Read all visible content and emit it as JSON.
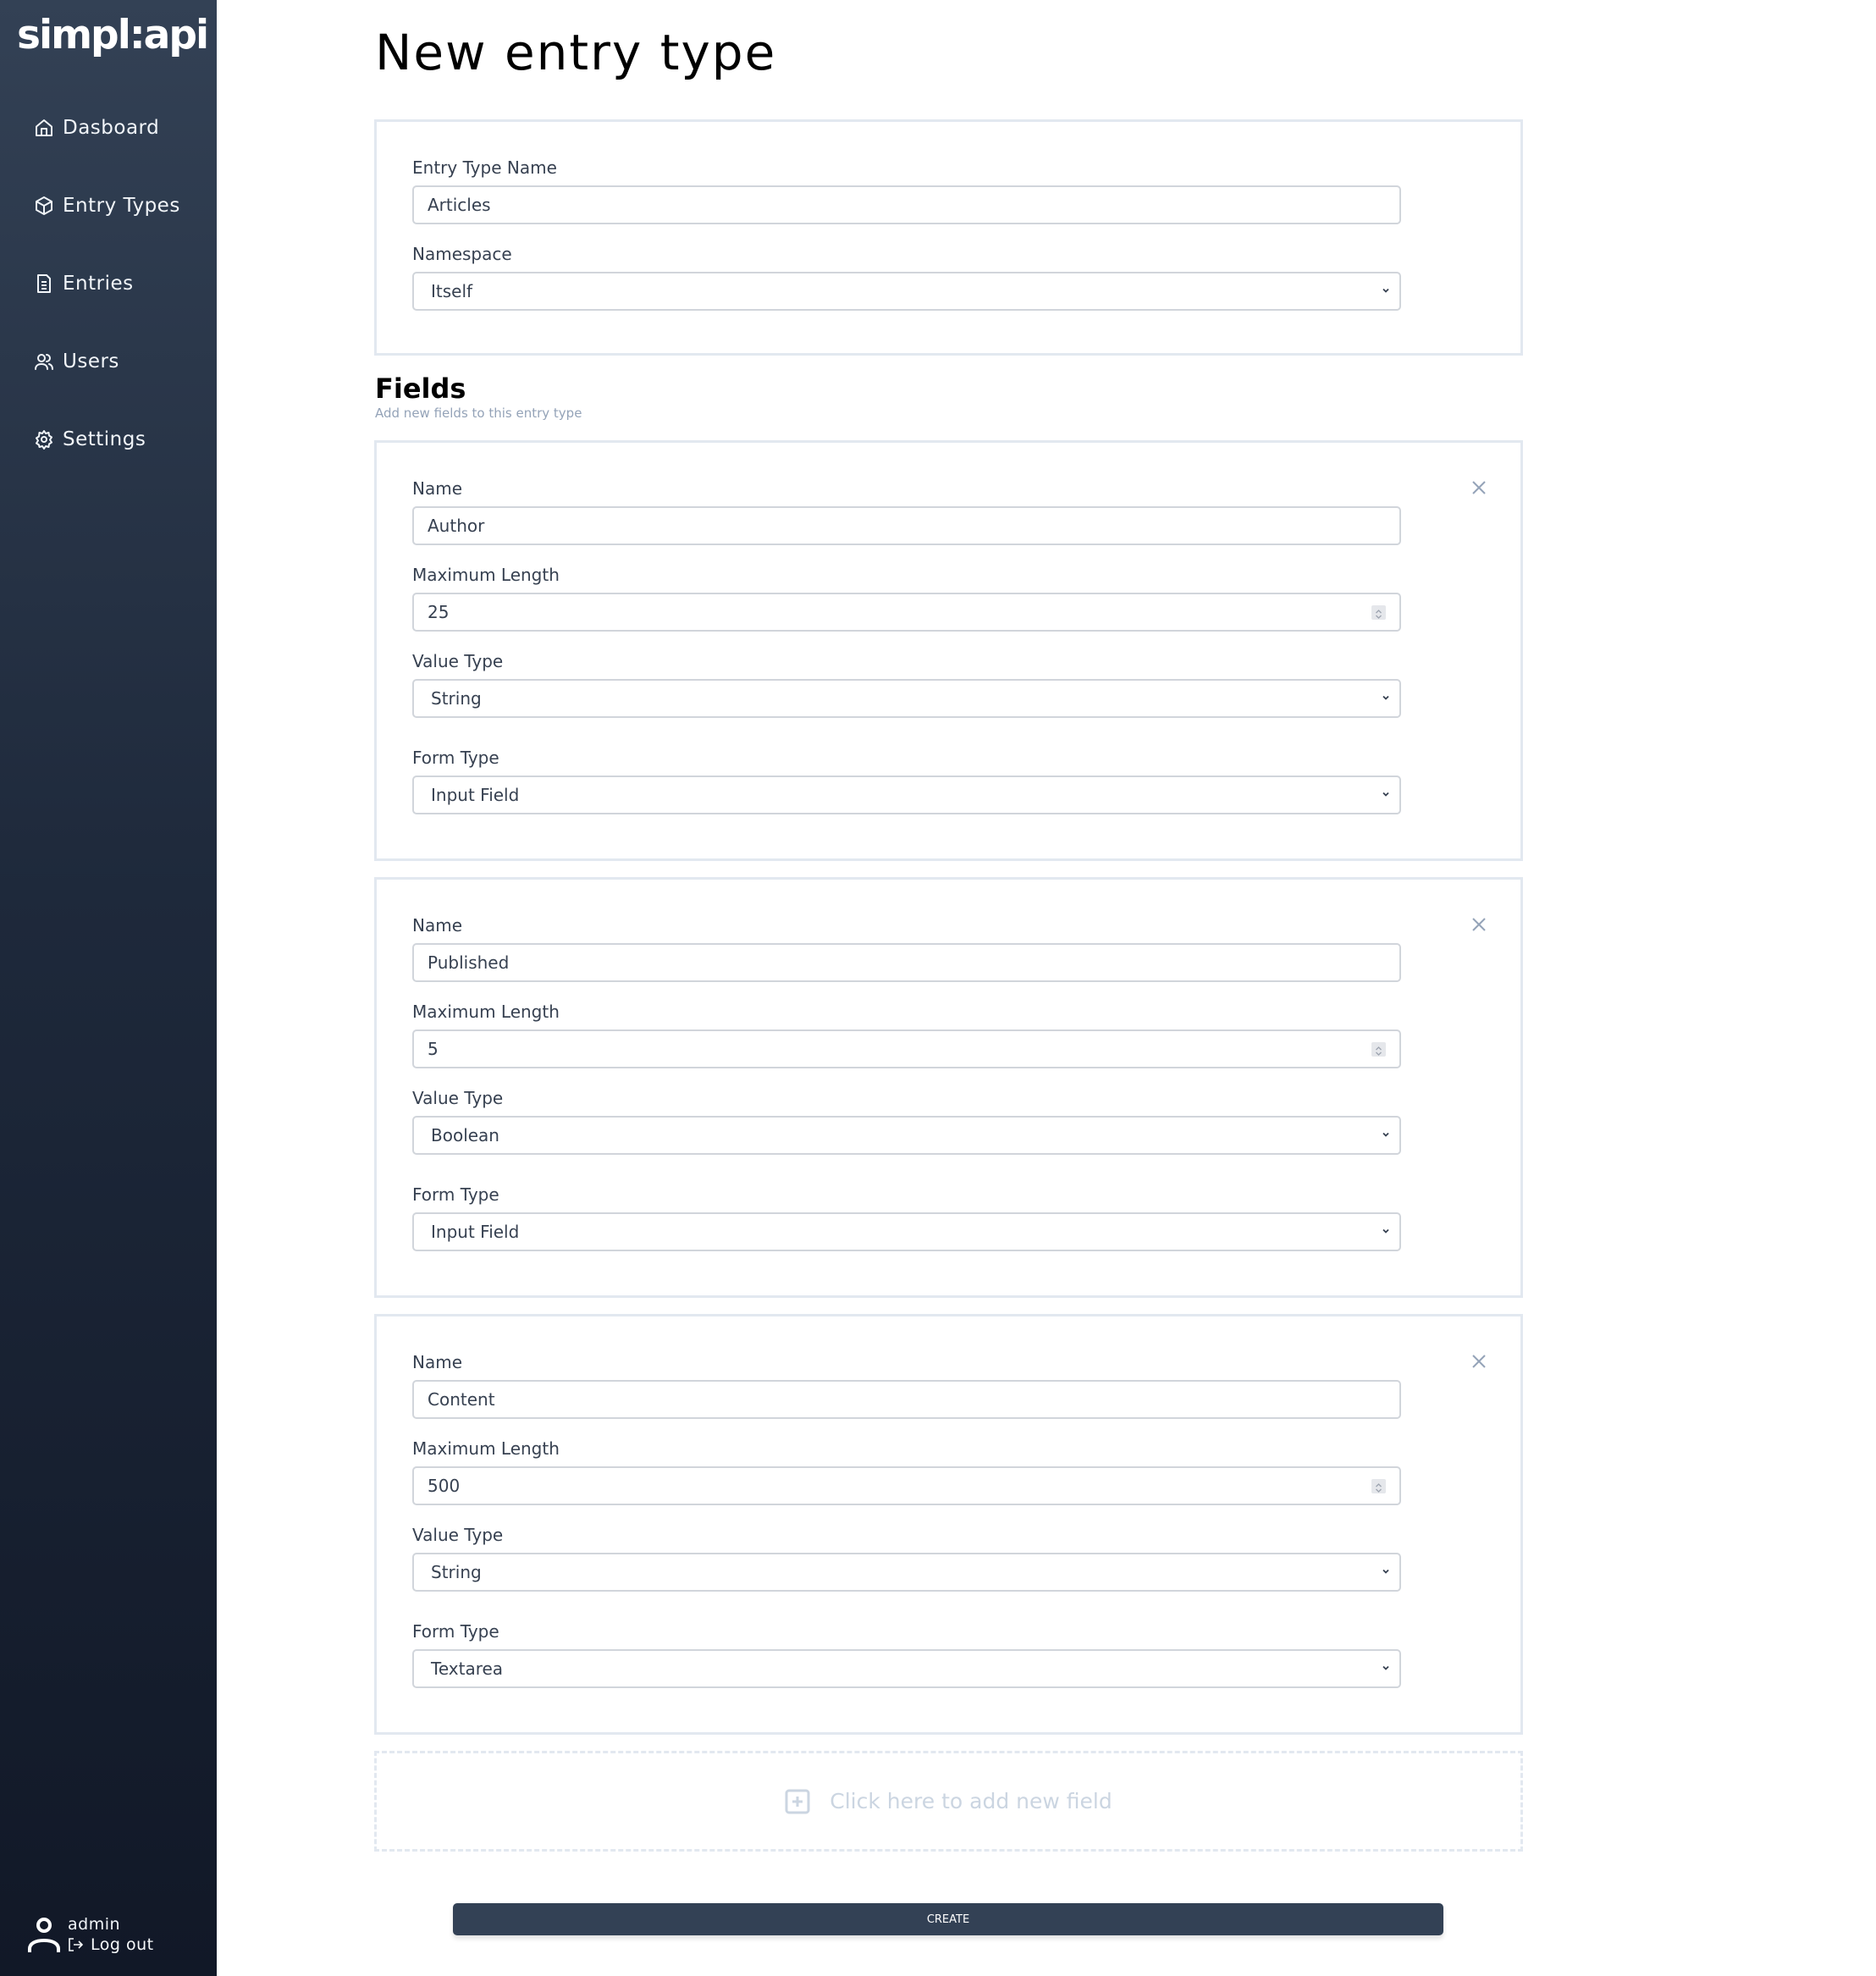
{
  "app": {
    "logo": "simpl:api"
  },
  "sidebar": {
    "items": [
      {
        "label": "Dasboard",
        "icon": "home-icon"
      },
      {
        "label": "Entry Types",
        "icon": "cube-icon"
      },
      {
        "label": "Entries",
        "icon": "document-icon"
      },
      {
        "label": "Users",
        "icon": "users-icon"
      },
      {
        "label": "Settings",
        "icon": "gear-icon"
      }
    ],
    "user": {
      "name": "admin",
      "logout_label": "Log out"
    }
  },
  "page": {
    "title": "New entry type"
  },
  "entry_type": {
    "name_label": "Entry Type Name",
    "name_value": "Articles",
    "namespace_label": "Namespace",
    "namespace_value": "Itself"
  },
  "fields_section": {
    "heading": "Fields",
    "subtitle": "Add new fields to this entry type",
    "labels": {
      "name": "Name",
      "max_length": "Maximum Length",
      "value_type": "Value Type",
      "form_type": "Form Type"
    },
    "fields": [
      {
        "name": "Author",
        "max_length": "25",
        "value_type": "String",
        "form_type": "Input Field"
      },
      {
        "name": "Published",
        "max_length": "5",
        "value_type": "Boolean",
        "form_type": "Input Field"
      },
      {
        "name": "Content",
        "max_length": "500",
        "value_type": "String",
        "form_type": "Textarea"
      }
    ],
    "add_field_label": "Click here to add new field"
  },
  "actions": {
    "create_label": "CREATE"
  },
  "colors": {
    "sidebar_top": "#334155",
    "sidebar_bottom": "#111827",
    "button_bg": "#334155",
    "card_border": "#e2e8f0",
    "muted_text": "#94a3b8"
  }
}
